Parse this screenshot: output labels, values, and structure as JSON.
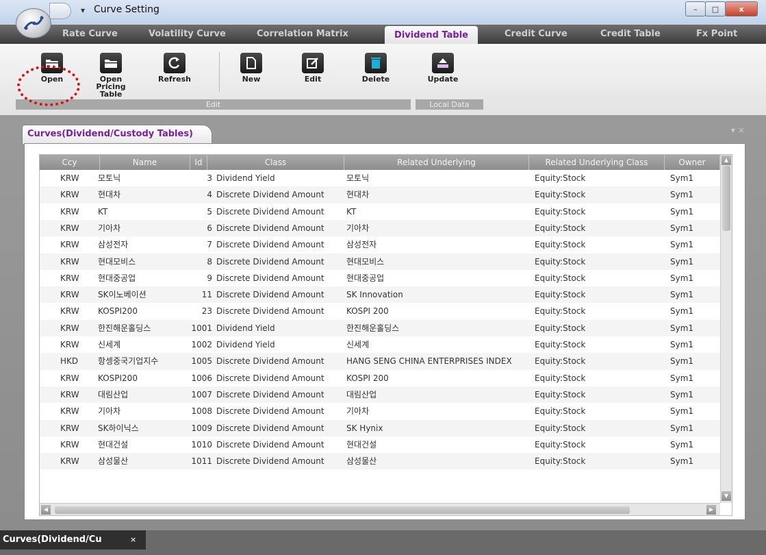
{
  "window": {
    "title": "Curve Setting",
    "controls": {
      "minimize": "–",
      "maximize": "□",
      "close": "x"
    }
  },
  "ribbon_tabs": [
    {
      "label": "Rate Curve",
      "active": false
    },
    {
      "label": "Volatility Curve",
      "active": false
    },
    {
      "label": "Correlation Matrix",
      "active": false
    },
    {
      "label": "Dividend Table",
      "active": true
    },
    {
      "label": "Credit Curve",
      "active": false
    },
    {
      "label": "Credit Table",
      "active": false
    },
    {
      "label": "Fx Point",
      "active": false
    }
  ],
  "toolbar": {
    "buttons": [
      {
        "label": "Open",
        "icon": "folder-icon"
      },
      {
        "label": "Open Pricing Table",
        "icon": "folder-icon"
      },
      {
        "label": "Refresh",
        "icon": "refresh-icon"
      },
      {
        "label": "New",
        "icon": "new-document-icon"
      },
      {
        "label": "Edit",
        "icon": "edit-icon"
      },
      {
        "label": "Delete",
        "icon": "trash-icon"
      },
      {
        "label": "Update",
        "icon": "upload-icon"
      }
    ],
    "groups": {
      "edit": "Edit",
      "local_data": "Local Data"
    }
  },
  "panel": {
    "tab_label": "Curves(Dividend/Custody Tables)",
    "controls": "▾ ×"
  },
  "grid": {
    "columns": [
      "Ccy",
      "Name",
      "Id",
      "Class",
      "Related Underlying",
      "Related Underlying Class",
      "Owner"
    ],
    "rows": [
      [
        "KRW",
        "모토닉",
        "3",
        "Dividend Yield",
        "모토닉",
        "Equity:Stock",
        "Sym1"
      ],
      [
        "KRW",
        "현대차",
        "4",
        "Discrete Dividend Amount",
        "현대차",
        "Equity:Stock",
        "Sym1"
      ],
      [
        "KRW",
        "KT",
        "5",
        "Discrete Dividend Amount",
        "KT",
        "Equity:Stock",
        "Sym1"
      ],
      [
        "KRW",
        "기아차",
        "6",
        "Discrete Dividend Amount",
        "기아차",
        "Equity:Stock",
        "Sym1"
      ],
      [
        "KRW",
        "삼성전자",
        "7",
        "Discrete Dividend Amount",
        "삼성전자",
        "Equity:Stock",
        "Sym1"
      ],
      [
        "KRW",
        "현대모비스",
        "8",
        "Discrete Dividend Amount",
        "현대모비스",
        "Equity:Stock",
        "Sym1"
      ],
      [
        "KRW",
        "현대중공업",
        "9",
        "Discrete Dividend Amount",
        "현대중공업",
        "Equity:Stock",
        "Sym1"
      ],
      [
        "KRW",
        "SK이노베이션",
        "11",
        "Discrete Dividend Amount",
        "SK Innovation",
        "Equity:Stock",
        "Sym1"
      ],
      [
        "KRW",
        "KOSPI200",
        "23",
        "Discrete Dividend Amount",
        "KOSPI 200",
        "Equity:Stock",
        "Sym1"
      ],
      [
        "KRW",
        "한진해운홀딩스",
        "1001",
        "Dividend Yield",
        "한진해운홀딩스",
        "Equity:Stock",
        "Sym1"
      ],
      [
        "KRW",
        "신세계",
        "1002",
        "Dividend Yield",
        "신세계",
        "Equity:Stock",
        "Sym1"
      ],
      [
        "HKD",
        "항셍중국기업지수",
        "1005",
        "Discrete Dividend Amount",
        "HANG SENG CHINA ENTERPRISES INDEX",
        "Equity:Stock",
        "Sym1"
      ],
      [
        "KRW",
        "KOSPI200",
        "1006",
        "Discrete Dividend Amount",
        "KOSPI 200",
        "Equity:Stock",
        "Sym1"
      ],
      [
        "KRW",
        "대림산업",
        "1007",
        "Discrete Dividend Amount",
        "대림산업",
        "Equity:Stock",
        "Sym1"
      ],
      [
        "KRW",
        "기아차",
        "1008",
        "Discrete Dividend Amount",
        "기아차",
        "Equity:Stock",
        "Sym1"
      ],
      [
        "KRW",
        "SK하이닉스",
        "1009",
        "Discrete Dividend Amount",
        "SK Hynix",
        "Equity:Stock",
        "Sym1"
      ],
      [
        "KRW",
        "현대건설",
        "1010",
        "Discrete Dividend Amount",
        "현대건설",
        "Equity:Stock",
        "Sym1"
      ],
      [
        "KRW",
        "삼성물산",
        "1011",
        "Discrete Dividend Amount",
        "삼성물산",
        "Equity:Stock",
        "Sym1"
      ]
    ]
  },
  "bottom_tab": {
    "label": "Curves(Dividend/Cu",
    "close": "×"
  },
  "colors": {
    "accent_purple": "#7b1fa2",
    "highlight_red": "#e01010",
    "grid_header": "#9a9a9a",
    "close_button": "#c7412a"
  }
}
